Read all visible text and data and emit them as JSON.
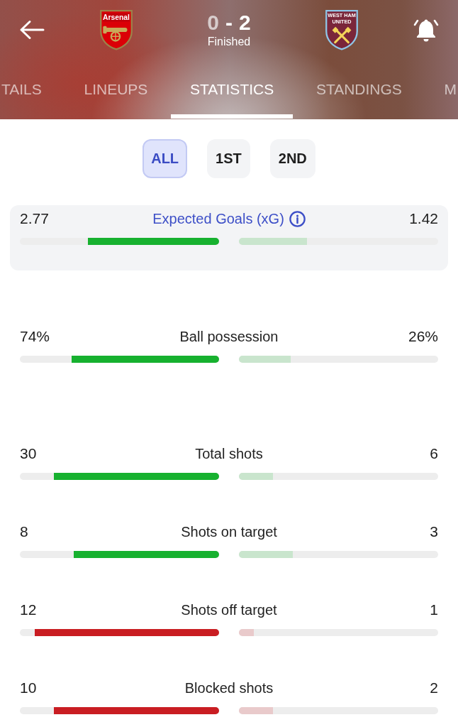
{
  "header": {
    "home_team": {
      "crest_text": "Arsenal",
      "score": "0",
      "winner": false
    },
    "score_separator": "-",
    "away_team": {
      "crest_text": "WEST HAM",
      "crest_subtext": "UNITED",
      "score": "2",
      "winner": true
    },
    "status": "Finished"
  },
  "tabs": [
    {
      "label": "TAILS",
      "selected": false
    },
    {
      "label": "LINEUPS",
      "selected": false
    },
    {
      "label": "STATISTICS",
      "selected": true
    },
    {
      "label": "STANDINGS",
      "selected": false
    },
    {
      "label": "M",
      "selected": false
    }
  ],
  "periods": [
    {
      "label": "ALL",
      "selected": true
    },
    {
      "label": "1ST",
      "selected": false
    },
    {
      "label": "2ND",
      "selected": false
    }
  ],
  "sections": [
    {
      "kind": "highlight",
      "stats": [
        {
          "title": "Expected Goals (xG)",
          "info": true,
          "color": "#17b12f",
          "home": {
            "value": "2.77",
            "level": 0.66
          },
          "away": {
            "value": "1.42",
            "level": 0.34
          }
        }
      ]
    },
    {
      "kind": "plain",
      "stats": [
        {
          "title": "Ball possession",
          "info": false,
          "color": "#17b12f",
          "home": {
            "value": "74%",
            "level": 0.74
          },
          "away": {
            "value": "26%",
            "level": 0.26
          }
        }
      ]
    },
    {
      "kind": "plain",
      "stats": [
        {
          "title": "Total shots",
          "info": false,
          "color": "#17b12f",
          "home": {
            "value": "30",
            "level": 0.83
          },
          "away": {
            "value": "6",
            "level": 0.17
          }
        },
        {
          "title": "Shots on target",
          "info": false,
          "color": "#17b12f",
          "home": {
            "value": "8",
            "level": 0.73
          },
          "away": {
            "value": "3",
            "level": 0.27
          }
        },
        {
          "title": "Shots off target",
          "info": false,
          "color": "#c91d22",
          "home": {
            "value": "12",
            "level": 0.925
          },
          "away": {
            "value": "1",
            "level": 0.075
          }
        },
        {
          "title": "Blocked shots",
          "info": false,
          "color": "#c91d22",
          "home": {
            "value": "10",
            "level": 0.83
          },
          "away": {
            "value": "2",
            "level": 0.17
          }
        }
      ]
    }
  ]
}
